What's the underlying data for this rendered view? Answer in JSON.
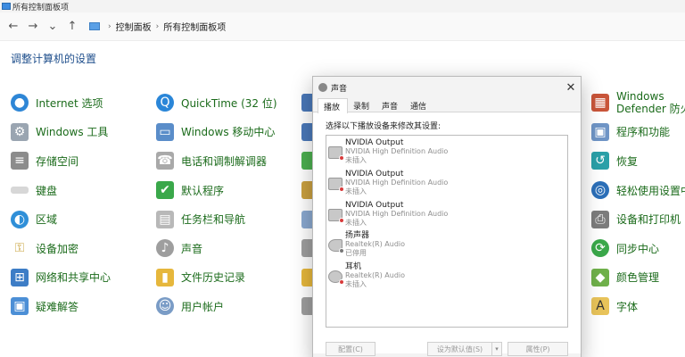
{
  "window": {
    "title": "所有控制面板项"
  },
  "nav": {
    "back": "←",
    "forward": "→",
    "recent": "⌄",
    "up": "↑",
    "crumbs": [
      "控制面板",
      "所有控制面板项"
    ],
    "separator": "›"
  },
  "heading": "调整计算机的设置",
  "columns": {
    "c1": [
      "Internet 选项",
      "Windows 工具",
      "存储空间",
      "键盘",
      "区域",
      "设备加密",
      "网络和共享中心",
      "疑难解答"
    ],
    "c2": [
      "QuickTime (32 位)",
      "Windows 移动中心",
      "电话和调制解调器",
      "默认程序",
      "任务栏和导航",
      "声音",
      "文件历史记录",
      "用户帐户"
    ],
    "c4": [
      "Windows Defender 防火墙",
      "程序和功能",
      "恢复",
      "轻松使用设置中心",
      "设备和打印机",
      "同步中心",
      "颜色管理",
      "字体"
    ]
  },
  "icons": {
    "c1": [
      "globe-icon",
      "tools-icon",
      "storage-icon",
      "keyboard-icon",
      "region-icon",
      "encryption-icon",
      "network-icon",
      "troubleshoot-icon"
    ],
    "c2": [
      "quicktime-icon",
      "mobility-icon",
      "phone-modem-icon",
      "default-programs-icon",
      "taskbar-icon",
      "sound-icon",
      "file-history-icon",
      "user-accounts-icon"
    ],
    "c4": [
      "firewall-icon",
      "programs-icon",
      "recovery-icon",
      "ease-of-access-icon",
      "devices-printers-icon",
      "sync-icon",
      "color-management-icon",
      "font-icon"
    ]
  },
  "dialog": {
    "title": "声音",
    "close": "✕",
    "tabs": [
      "播放",
      "录制",
      "声音",
      "通信"
    ],
    "active_tab": "播放",
    "instruction": "选择以下播放设备来修改其设置:",
    "devices": [
      {
        "name": "NVIDIA Output",
        "desc": "NVIDIA High Definition Audio",
        "status": "未插入"
      },
      {
        "name": "NVIDIA Output",
        "desc": "NVIDIA High Definition Audio",
        "status": "未插入"
      },
      {
        "name": "NVIDIA Output",
        "desc": "NVIDIA High Definition Audio",
        "status": "未插入"
      },
      {
        "name": "扬声器",
        "desc": "Realtek(R) Audio",
        "status": "已停用"
      },
      {
        "name": "耳机",
        "desc": "Realtek(R) Audio",
        "status": "未插入"
      }
    ],
    "buttons": {
      "configure": "配置(C)",
      "set_default": "设为默认值(S)",
      "dropdown": "▾",
      "properties": "属性(P)"
    }
  },
  "colors": {
    "link_green": "#1b6b1b",
    "heading_blue": "#1f4f8c"
  }
}
